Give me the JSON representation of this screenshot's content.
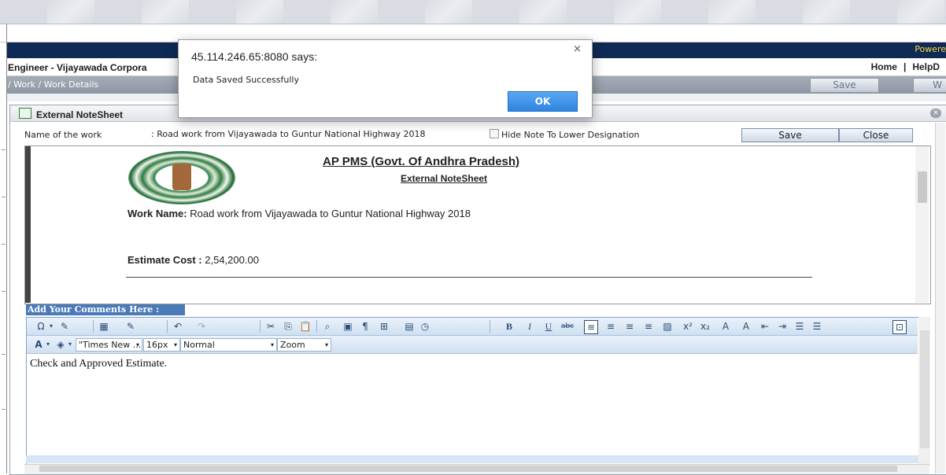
{
  "app": {
    "powered": "Powere",
    "org_name": "Engineer - Vijayawada Corpora",
    "toplinks": [
      "Home",
      "|",
      "HelpD"
    ],
    "breadcrumb": "/ Work / Work Details",
    "top_save": "Save",
    "top_w": "W"
  },
  "panel": {
    "title": "External NoteSheet",
    "close_icon": "close-icon",
    "name_label": "Name of the work",
    "name_value": ": Road work from Vijayawada to Guntur National Highway 2018",
    "hide_note_label": "Hide Note To Lower Designation",
    "save_label": "Save",
    "close_label": "Close"
  },
  "note": {
    "heading": "AP PMS (Govt. Of Andhra Pradesh)",
    "subheading": "External NoteSheet",
    "work_name_label": "Work Name:",
    "work_name_value": " Road work from Vijayawada to Guntur National Highway 2018",
    "estimate_label": "Estimate Cost :",
    "estimate_value": " 2,54,200.00"
  },
  "editor": {
    "comments_header": "Add Your Comments Here :",
    "font_name": "\"Times New ...",
    "font_size": "16px",
    "paragraph": "Normal",
    "zoom": "Zoom",
    "content": "Check and Approved Estimate."
  },
  "dialog": {
    "title": "45.114.246.65:8080 says:",
    "message": "Data Saved Successfully",
    "ok_label": "OK",
    "close_glyph": "×"
  }
}
